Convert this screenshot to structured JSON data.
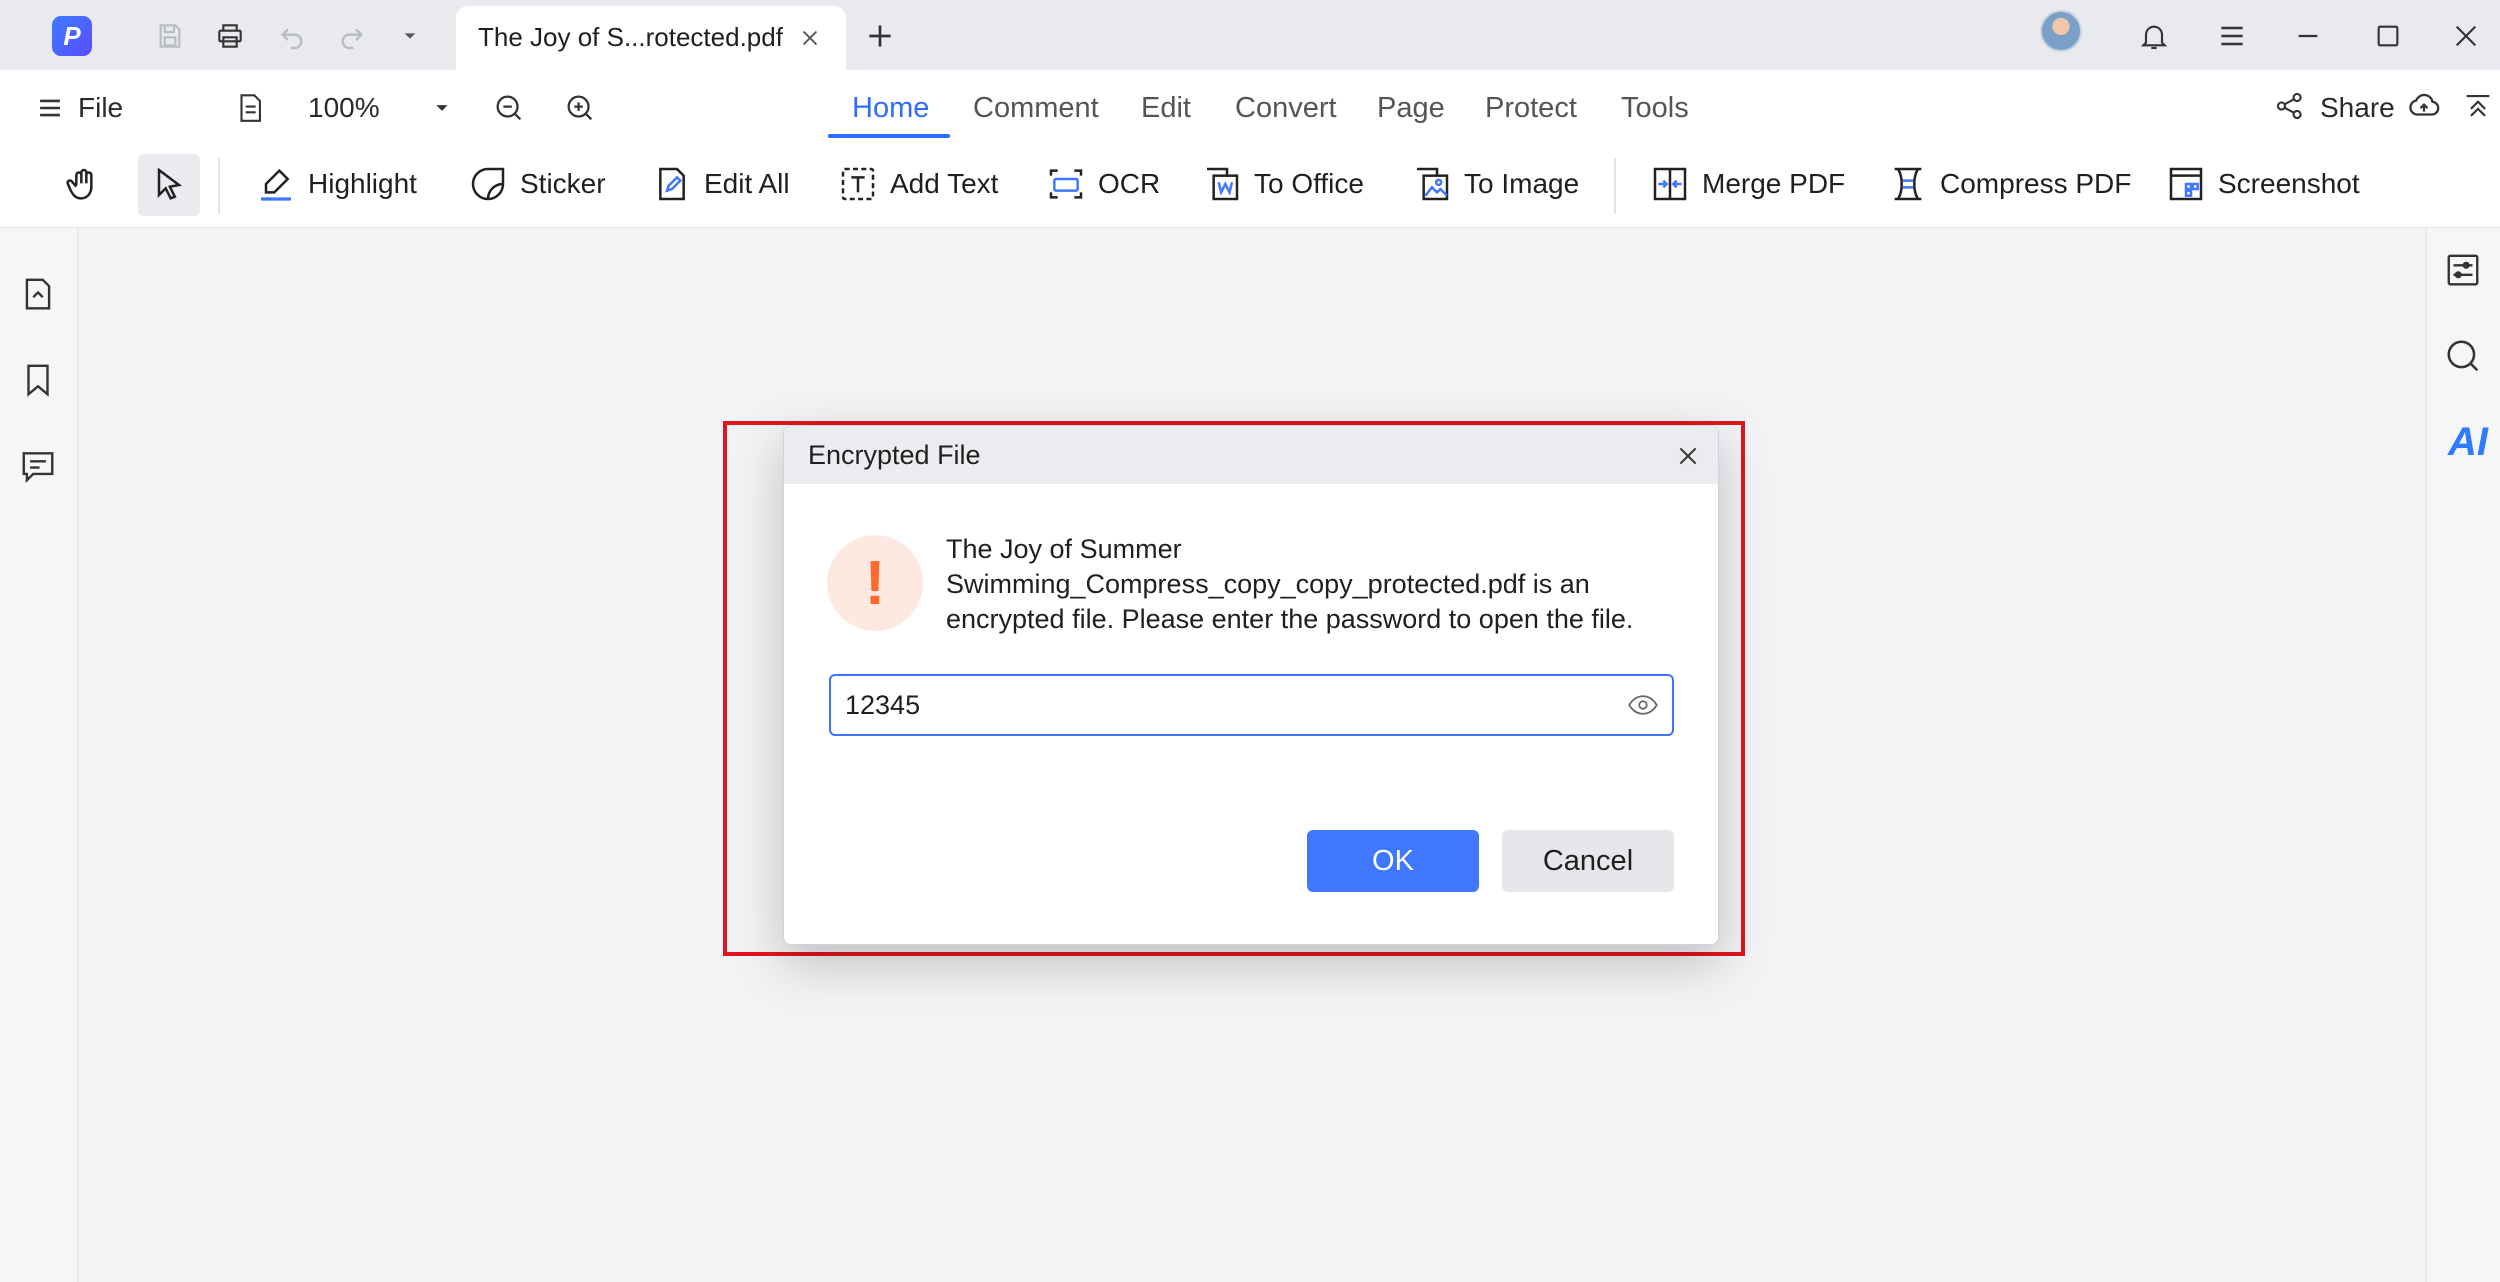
{
  "titlebar": {
    "tab_title": "The Joy of S...rotected.pdf"
  },
  "menubar": {
    "file_label": "File",
    "zoom_value": "100%",
    "tabs": [
      {
        "label": "Home",
        "active": true
      },
      {
        "label": "Comment"
      },
      {
        "label": "Edit"
      },
      {
        "label": "Convert"
      },
      {
        "label": "Page"
      },
      {
        "label": "Protect"
      },
      {
        "label": "Tools"
      }
    ],
    "share_label": "Share"
  },
  "toolbar": {
    "tools": [
      {
        "label": "Highlight",
        "icon": "highlight-icon"
      },
      {
        "label": "Sticker",
        "icon": "sticker-icon"
      },
      {
        "label": "Edit All",
        "icon": "edit-all-icon"
      },
      {
        "label": "Add Text",
        "icon": "add-text-icon"
      },
      {
        "label": "OCR",
        "icon": "ocr-icon"
      },
      {
        "label": "To Office",
        "icon": "to-office-icon"
      },
      {
        "label": "To Image",
        "icon": "to-image-icon"
      },
      {
        "label": "Merge PDF",
        "icon": "merge-pdf-icon"
      },
      {
        "label": "Compress PDF",
        "icon": "compress-pdf-icon"
      },
      {
        "label": "Screenshot",
        "icon": "screenshot-icon"
      }
    ]
  },
  "right_panel": {
    "ai_label": "AI"
  },
  "dialog": {
    "title": "Encrypted File",
    "message": "The Joy of Summer Swimming_Compress_copy_copy_protected.pdf is an encrypted file. Please enter the password to open the file.",
    "password_value": "12345",
    "ok_label": "OK",
    "cancel_label": "Cancel"
  },
  "colors": {
    "accent": "#3f78ff",
    "warning": "#ff6a2c",
    "highlight_frame": "#e0141e"
  }
}
